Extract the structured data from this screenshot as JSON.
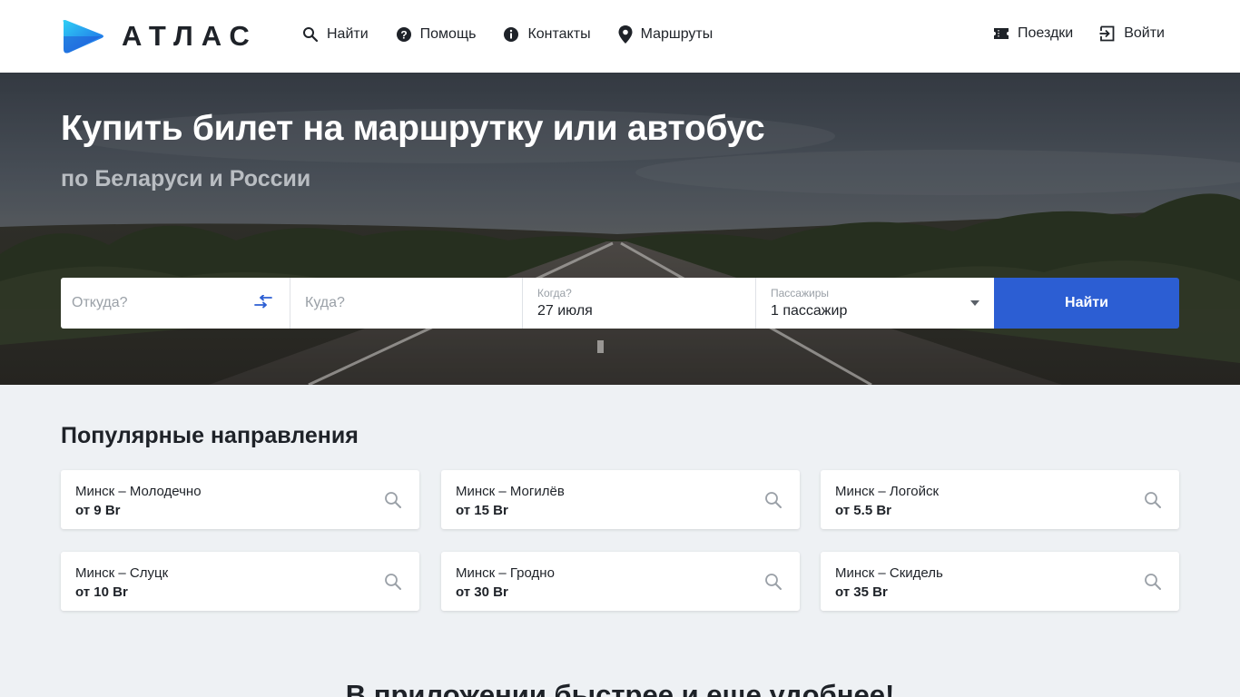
{
  "header": {
    "logo_text": "АТЛАС",
    "nav": [
      {
        "label": "Найти",
        "icon": "search-icon"
      },
      {
        "label": "Помощь",
        "icon": "help-icon"
      },
      {
        "label": "Контакты",
        "icon": "info-icon"
      },
      {
        "label": "Маршруты",
        "icon": "map-pin-icon"
      }
    ],
    "nav_right": [
      {
        "label": "Поездки",
        "icon": "ticket-icon"
      },
      {
        "label": "Войти",
        "icon": "login-icon"
      }
    ]
  },
  "hero": {
    "title": "Купить билет на маршрутку или автобус",
    "subtitle": "по Беларуси и России"
  },
  "search": {
    "from_placeholder": "Откуда?",
    "to_placeholder": "Куда?",
    "date_label": "Когда?",
    "date_value": "27 июля",
    "passengers_label": "Пассажиры",
    "passengers_value": "1 пассажир",
    "submit_label": "Найти"
  },
  "popular": {
    "title": "Популярные направления",
    "routes": [
      {
        "route": "Минск – Молодечно",
        "price": "от 9 Br"
      },
      {
        "route": "Минск – Могилёв",
        "price": "от 15 Br"
      },
      {
        "route": "Минск – Логойск",
        "price": "от 5.5 Br"
      },
      {
        "route": "Минск – Слуцк",
        "price": "от 10 Br"
      },
      {
        "route": "Минск – Гродно",
        "price": "от 30 Br"
      },
      {
        "route": "Минск – Скидель",
        "price": "от 35 Br"
      }
    ]
  },
  "app_promo": {
    "title": "В приложении быстрее и еще удобнее!"
  },
  "colors": {
    "accent": "#2c5ed3",
    "logo_blue": "#1ea0f0",
    "page_bg": "#eef1f4"
  }
}
